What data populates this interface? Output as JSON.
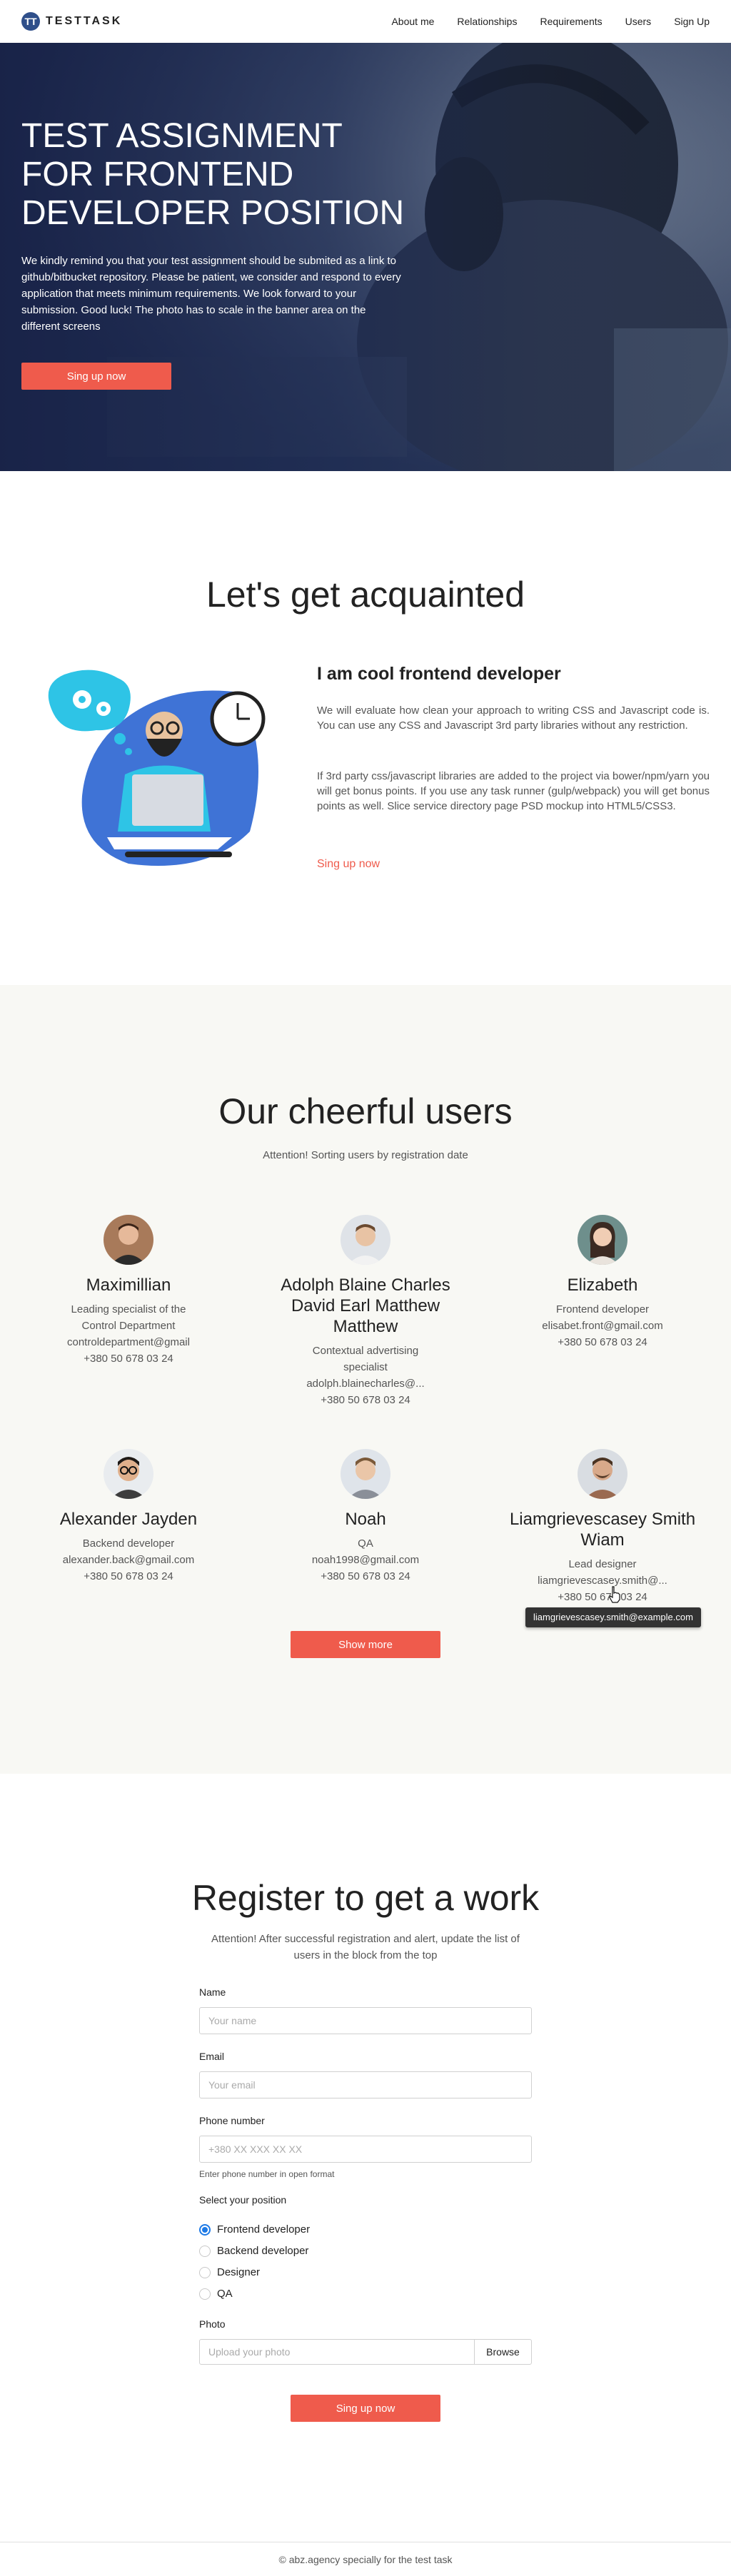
{
  "header": {
    "logo_mark": "TT",
    "logo_text": "TESTTASK",
    "nav": [
      "About me",
      "Relationships",
      "Requirements",
      "Users",
      "Sign Up"
    ]
  },
  "hero": {
    "title": "TEST ASSIGNMENT FOR FRONTEND DEVELOPER POSITION",
    "text": "We kindly remind you that your test assignment should be submited as a link to github/bitbucket repository. Please be patient, we consider and respond to every application that meets minimum requirements. We look forward to your submission. Good luck! The photo has to scale in the banner area on the different screens",
    "button": "Sing up now"
  },
  "acquainted": {
    "title": "Let's get acquainted",
    "heading": "I am cool frontend developer",
    "p1": "We will evaluate how clean your approach to writing CSS and Javascript code is. You can use any CSS and Javascript 3rd party libraries without any restriction.",
    "p2": "If 3rd party css/javascript libraries are added to the project via bower/npm/yarn you will get bonus points. If you use any task runner (gulp/webpack) you will get bonus points as well. Slice service directory page PSD mockup into HTML5/CSS3.",
    "link": "Sing up now"
  },
  "users": {
    "title": "Our cheerful users",
    "subtitle": "Attention! Sorting users by registration date",
    "list": [
      {
        "name": "Maximillian",
        "lines": [
          "Leading specialist of the",
          "Control Department",
          "controldepartment@gmail",
          "+380 50 678 03 24"
        ]
      },
      {
        "name": "Adolph Blaine Charles David Earl Matthew Matthew",
        "lines": [
          "Contextual advertising",
          "specialist",
          "adolph.blainecharles@...",
          "+380 50 678 03 24"
        ]
      },
      {
        "name": "Elizabeth",
        "lines": [
          "Frontend developer",
          "elisabet.front@gmail.com",
          "+380 50 678 03 24"
        ]
      },
      {
        "name": "Alexander Jayden",
        "lines": [
          "Backend developer",
          "alexander.back@gmail.com",
          "+380 50 678 03 24"
        ]
      },
      {
        "name": "Noah",
        "lines": [
          "QA",
          "noah1998@gmail.com",
          "+380 50 678 03 24"
        ]
      },
      {
        "name": "Liamgrievescasey Smith Wiam",
        "lines": [
          "Lead designer",
          "liamgrievescasey.smith@...",
          "+380 50 678 03 24"
        ]
      }
    ],
    "show_more": "Show more",
    "tooltip": "liamgrievescasey.smith@example.com"
  },
  "register": {
    "title": "Register to get a work",
    "subtitle": "Attention! After successful registration and alert, update the list of users in the block from the top",
    "name_label": "Name",
    "name_placeholder": "Your name",
    "email_label": "Email",
    "email_placeholder": "Your email",
    "phone_label": "Phone number",
    "phone_placeholder": "+380 XX XXX XX XX",
    "phone_hint": "Enter phone number in open format",
    "position_label": "Select your position",
    "positions": [
      "Frontend developer",
      "Backend developer",
      "Designer",
      "QA"
    ],
    "selected_position": "Frontend developer",
    "photo_label": "Photo",
    "photo_placeholder": "Upload your photo",
    "browse": "Browse",
    "submit": "Sing up now"
  },
  "footer": {
    "text": "© abz.agency specially for the test task"
  },
  "colors": {
    "accent": "#ef5b4c",
    "brand": "#2f4f8a",
    "radio": "#1e7ae6",
    "users_bg": "#f8f8f4"
  }
}
